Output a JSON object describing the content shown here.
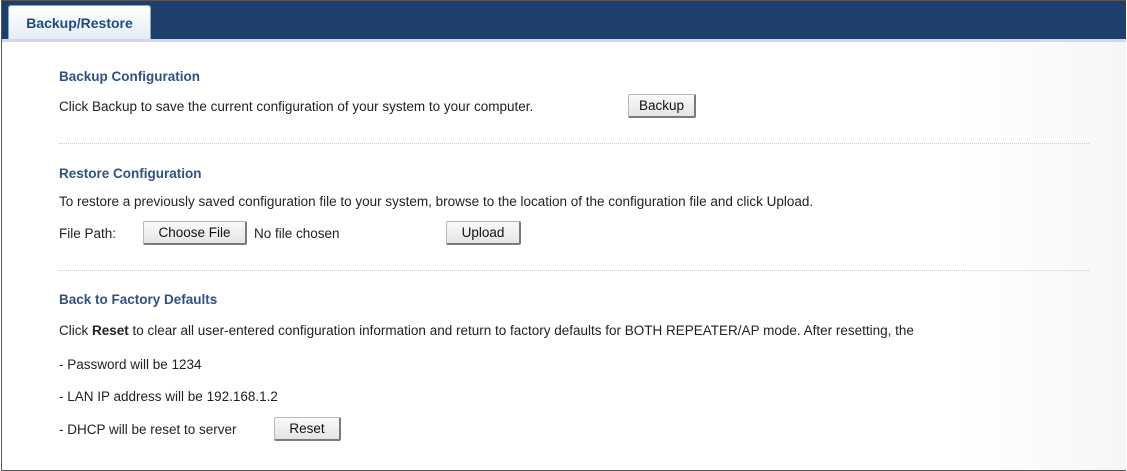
{
  "tab": {
    "label": "Backup/Restore"
  },
  "backup": {
    "title": "Backup Configuration",
    "description": "Click Backup to save the current configuration of your system to your computer.",
    "button": "Backup"
  },
  "restore": {
    "title": "Restore Configuration",
    "description": "To restore a previously saved configuration file to your system, browse to the location of the configuration file and click Upload.",
    "file_path_label": "File Path:",
    "choose_file_button": "Choose File",
    "file_status": "No file chosen",
    "upload_button": "Upload"
  },
  "factory": {
    "title": "Back to Factory Defaults",
    "desc_pre": "Click ",
    "desc_bold": "Reset",
    "desc_post": " to clear all user-entered configuration information and return to factory defaults for BOTH REPEATER/AP mode. After resetting, the",
    "item_password": "- Password will be 1234",
    "item_lan": "- LAN IP address will be 192.168.1.2",
    "item_dhcp": "- DHCP will be reset to server",
    "reset_button": "Reset"
  },
  "colors": {
    "tabbar": "#1e3f6b",
    "section_title": "#2f5283",
    "tab_text": "#1f4a86"
  }
}
